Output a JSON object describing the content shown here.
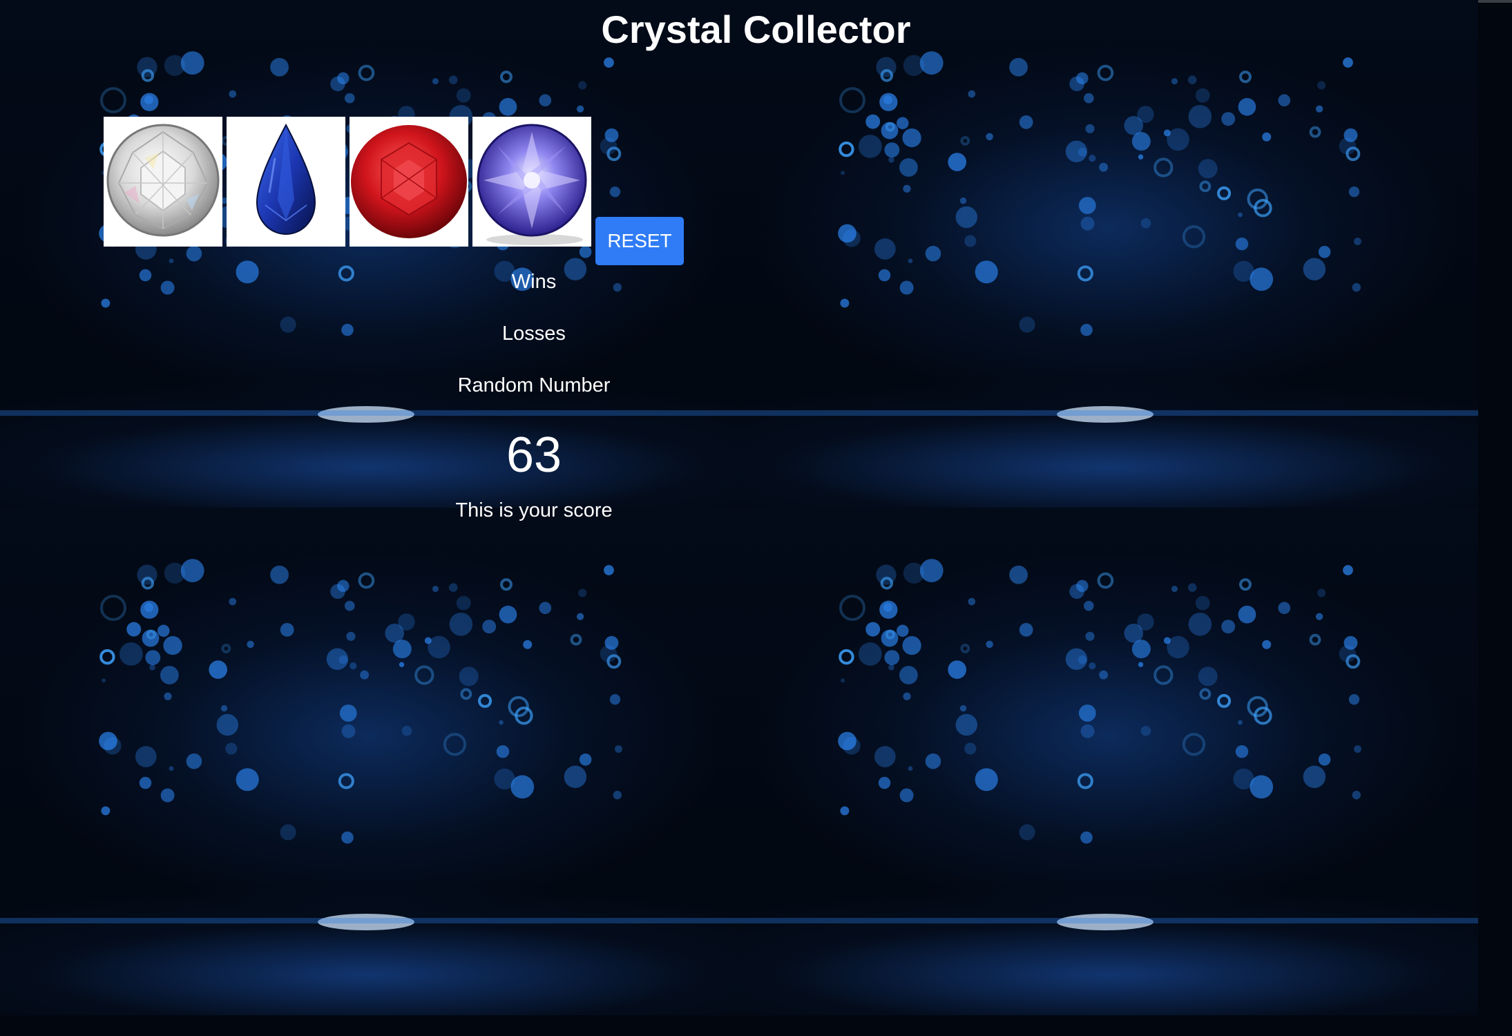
{
  "header": {
    "title": "Crystal Collector"
  },
  "crystals": [
    {
      "name": "diamond",
      "color": "#e6e6e6"
    },
    {
      "name": "sapphire",
      "color": "#1f3fae"
    },
    {
      "name": "ruby",
      "color": "#c8131b"
    },
    {
      "name": "amethyst",
      "color": "#5a4fd6"
    }
  ],
  "controls": {
    "reset_label": "RESET"
  },
  "stats": {
    "wins_label": "Wins",
    "losses_label": "Losses",
    "random_label": "Random Number",
    "score": "63",
    "score_label": "This is your score"
  },
  "colors": {
    "button": "#2f7cf6",
    "background": "#01060f",
    "text": "#ffffff"
  }
}
